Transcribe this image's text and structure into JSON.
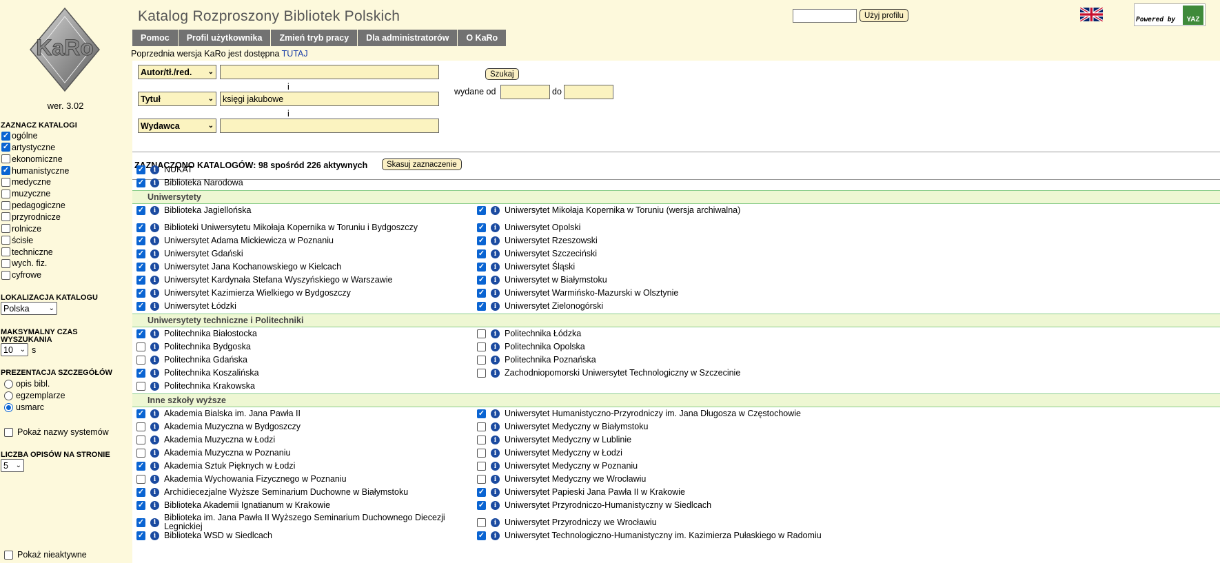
{
  "header": {
    "app_title": "Katalog Rozproszony Bibliotek Polskich",
    "profile_button": "Użyj profilu",
    "powered_by": "Powered by",
    "powered_logo": "YAZ",
    "flag_icon": "uk-flag-icon",
    "nav": [
      "Pomoc",
      "Profil użytkownika",
      "Zmień tryb pracy",
      "Dla administratorów",
      "O KaRo"
    ],
    "notice_text": "Poprzednia wersja KaRo jest dostępna ",
    "notice_link": "TUTAJ"
  },
  "sidebar": {
    "logo_text": "KaRo",
    "version": "wer. 3.02",
    "catalogs_heading": "ZAZNACZ KATALOGI",
    "catalogs": [
      {
        "label": "ogólne",
        "checked": true
      },
      {
        "label": "artystyczne",
        "checked": true
      },
      {
        "label": "ekonomiczne",
        "checked": false
      },
      {
        "label": "humanistyczne",
        "checked": true
      },
      {
        "label": "medyczne",
        "checked": false
      },
      {
        "label": "muzyczne",
        "checked": false
      },
      {
        "label": "pedagogiczne",
        "checked": false
      },
      {
        "label": "przyrodnicze",
        "checked": false
      },
      {
        "label": "rolnicze",
        "checked": false
      },
      {
        "label": "ścisłe",
        "checked": false
      },
      {
        "label": "techniczne",
        "checked": false
      },
      {
        "label": "wych. fiz.",
        "checked": false
      },
      {
        "label": "cyfrowe",
        "checked": false
      }
    ],
    "location_heading": "LOKALIZACJA KATALOGU",
    "location_value": "Polska",
    "time_heading_1": "MAKSYMALNY CZAS",
    "time_heading_2": "WYSZUKANIA",
    "time_value": "10",
    "time_unit": "s",
    "details_heading": "PREZENTACJA SZCZEGÓŁÓW",
    "details_options": [
      {
        "label": "opis bibl.",
        "selected": false
      },
      {
        "label": "egzemplarze",
        "selected": false
      },
      {
        "label": "usmarc",
        "selected": true
      }
    ],
    "show_systems": "Pokaż nazwy systemów",
    "per_page_heading": "LICZBA OPISÓW NA STRONIE",
    "per_page_value": "5",
    "show_inactive": "Pokaż nieaktywne"
  },
  "search": {
    "rows": [
      {
        "type": "Autor/tł./red.",
        "value": ""
      },
      {
        "type": "Tytuł",
        "value": "księgi jakubowe"
      },
      {
        "type": "Wydawca",
        "value": ""
      }
    ],
    "conjunction": "i",
    "search_button": "Szukaj",
    "published_from": "wydane od",
    "published_to": "do"
  },
  "selection": {
    "text": "ZAZNACZONO KATALOGÓW: 98 spośród 226 aktywnych",
    "clear_button": "Skasuj zaznaczenie"
  },
  "top_catalogs": [
    {
      "label": "NUKAT",
      "checked": true
    },
    {
      "label": "Biblioteka Narodowa",
      "checked": true
    }
  ],
  "groups": [
    {
      "title": "Uniwersytety",
      "left": [
        {
          "label": "Biblioteka Jagiellońska",
          "checked": true
        },
        {
          "label": "Biblioteki Uniwersytetu Mikołaja Kopernika w Toruniu i Bydgoszczy",
          "checked": true
        },
        {
          "label": "Uniwersytet Adama Mickiewicza w Poznaniu",
          "checked": true
        },
        {
          "label": "Uniwersytet Gdański",
          "checked": true
        },
        {
          "label": "Uniwersytet Jana Kochanowskiego w Kielcach",
          "checked": true
        },
        {
          "label": "Uniwersytet Kardynała Stefana Wyszyńskiego w Warszawie",
          "checked": true
        },
        {
          "label": "Uniwersytet Kazimierza Wielkiego w Bydgoszczy",
          "checked": true
        },
        {
          "label": "Uniwersytet Łódzki",
          "checked": true
        }
      ],
      "right": [
        {
          "label": "Uniwersytet Mikołaja Kopernika w Toruniu (wersja archiwalna)",
          "checked": true
        },
        {
          "label": "Uniwersytet Opolski",
          "checked": true
        },
        {
          "label": "Uniwersytet Rzeszowski",
          "checked": true
        },
        {
          "label": "Uniwersytet Szczeciński",
          "checked": true
        },
        {
          "label": "Uniwersytet Śląski",
          "checked": true
        },
        {
          "label": "Uniwersytet w Białymstoku",
          "checked": true
        },
        {
          "label": "Uniwersytet Warmińsko-Mazurski w Olsztynie",
          "checked": true
        },
        {
          "label": "Uniwersytet Zielonogórski",
          "checked": true
        }
      ]
    },
    {
      "title": "Uniwersytety techniczne i Politechniki",
      "left": [
        {
          "label": "Politechnika Białostocka",
          "checked": true
        },
        {
          "label": "Politechnika Bydgoska",
          "checked": false
        },
        {
          "label": "Politechnika Gdańska",
          "checked": false
        },
        {
          "label": "Politechnika Koszalińska",
          "checked": true
        },
        {
          "label": "Politechnika Krakowska",
          "checked": false
        }
      ],
      "right": [
        {
          "label": "Politechnika Łódzka",
          "checked": false
        },
        {
          "label": "Politechnika Opolska",
          "checked": false
        },
        {
          "label": "Politechnika Poznańska",
          "checked": false
        },
        {
          "label": "Zachodniopomorski Uniwersytet Technologiczny w Szczecinie",
          "checked": false
        }
      ]
    },
    {
      "title": "Inne szkoły wyższe",
      "left": [
        {
          "label": "Akademia Bialska im. Jana Pawła II",
          "checked": true
        },
        {
          "label": "Akademia Muzyczna w Bydgoszczy",
          "checked": false
        },
        {
          "label": "Akademia Muzyczna w Łodzi",
          "checked": false
        },
        {
          "label": "Akademia Muzyczna w Poznaniu",
          "checked": false
        },
        {
          "label": "Akademia Sztuk Pięknych w Łodzi",
          "checked": true
        },
        {
          "label": "Akademia Wychowania Fizycznego w Poznaniu",
          "checked": false
        },
        {
          "label": "Archidiecezjalne Wyższe Seminarium Duchowne w Białymstoku",
          "checked": true
        },
        {
          "label": "Biblioteka Akademii Ignatianum w Krakowie",
          "checked": true
        },
        {
          "label": "Biblioteka im. Jana Pawła II Wyższego Seminarium Duchownego Diecezji Legnickiej",
          "checked": true
        },
        {
          "label": "Biblioteka WSD w Siedlcach",
          "checked": true
        }
      ],
      "right": [
        {
          "label": "Uniwersytet Humanistyczno-Przyrodniczy im. Jana Długosza w Częstochowie",
          "checked": true
        },
        {
          "label": "Uniwersytet Medyczny w Białymstoku",
          "checked": false
        },
        {
          "label": "Uniwersytet Medyczny w Lublinie",
          "checked": false
        },
        {
          "label": "Uniwersytet Medyczny w Łodzi",
          "checked": false
        },
        {
          "label": "Uniwersytet Medyczny w Poznaniu",
          "checked": false
        },
        {
          "label": "Uniwersytet Medyczny we Wrocławiu",
          "checked": false
        },
        {
          "label": "Uniwersytet Papieski Jana Pawła II w Krakowie",
          "checked": true
        },
        {
          "label": "Uniwersytet Przyrodniczo-Humanistyczny w Siedlcach",
          "checked": true
        },
        {
          "label": "Uniwersytet Przyrodniczy we Wrocławiu",
          "checked": false
        },
        {
          "label": "Uniwersytet Technologiczno-Humanistyczny im. Kazimierza Pułaskiego w Radomiu",
          "checked": true
        }
      ]
    }
  ],
  "colors": {
    "page_bg": "#fdf9dc",
    "nav_bg": "#727272",
    "field_bg": "#fbf3c0",
    "group_bg": "#eef7d3",
    "checkbox_on": "#0a64d2",
    "info_icon": "#1a4aa0"
  }
}
